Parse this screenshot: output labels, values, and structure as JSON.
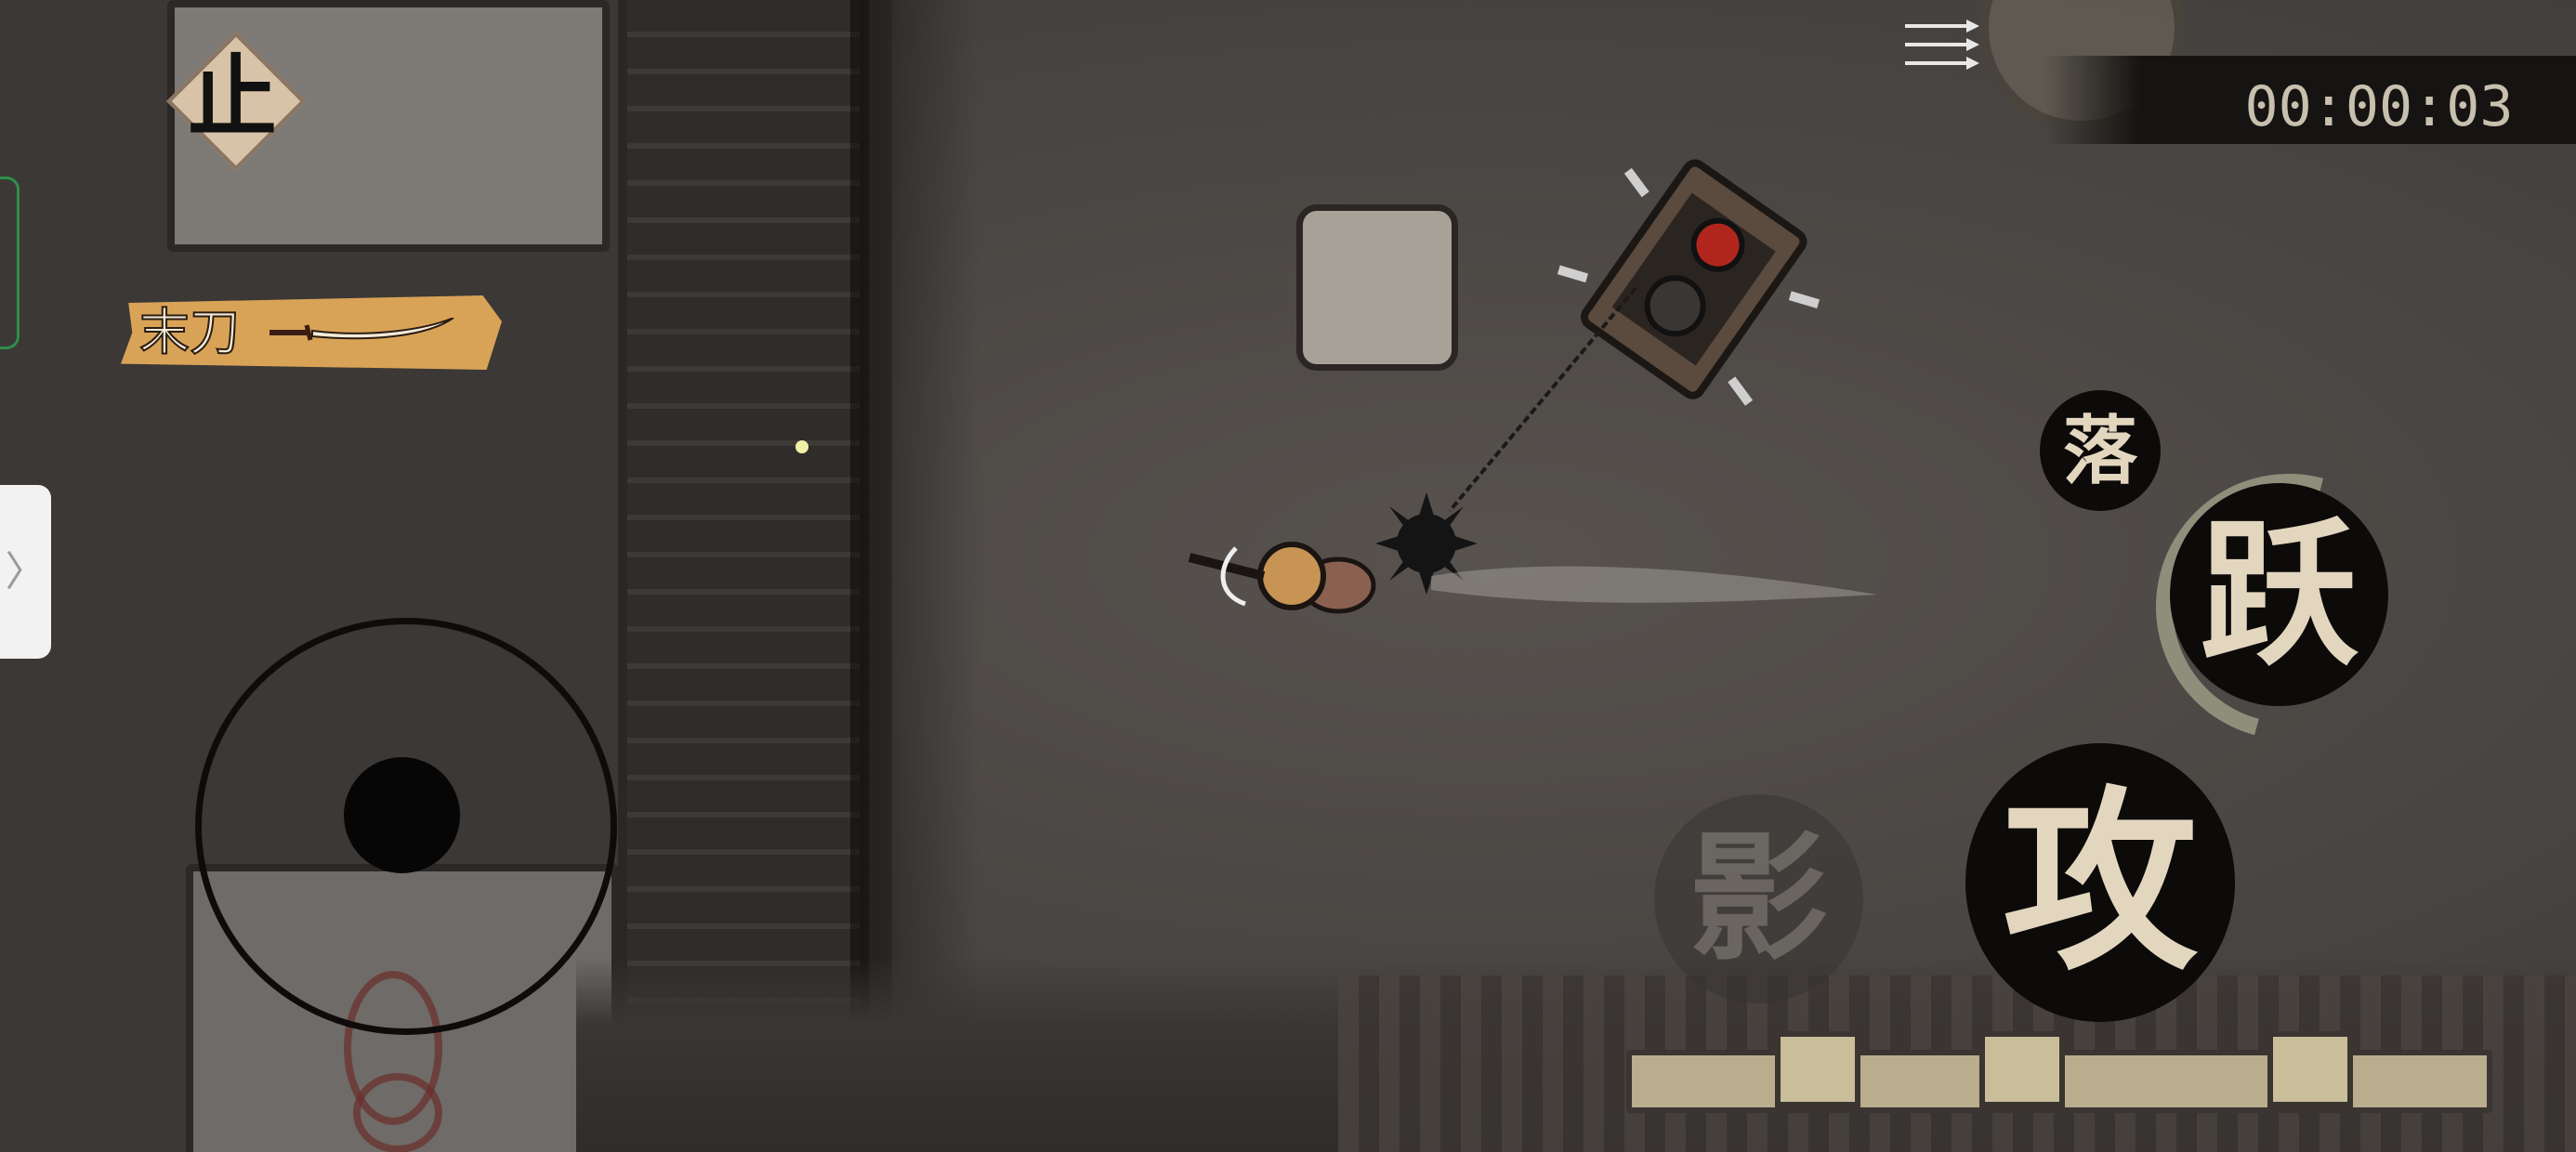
{
  "hud": {
    "timer": "00:00:03",
    "pause_label": "止",
    "weapon_label": "末刀",
    "side_handle_glyph": "〉"
  },
  "actions": {
    "fall_label": "落",
    "jump_label": "跃",
    "attack_label": "攻",
    "shadow_label": "影"
  },
  "colors": {
    "hud_text": "#c8c0ae",
    "weapon_banner": "#d9a357",
    "button_fill": "#0c0b0a",
    "button_glyph": "#e3d6bf"
  }
}
